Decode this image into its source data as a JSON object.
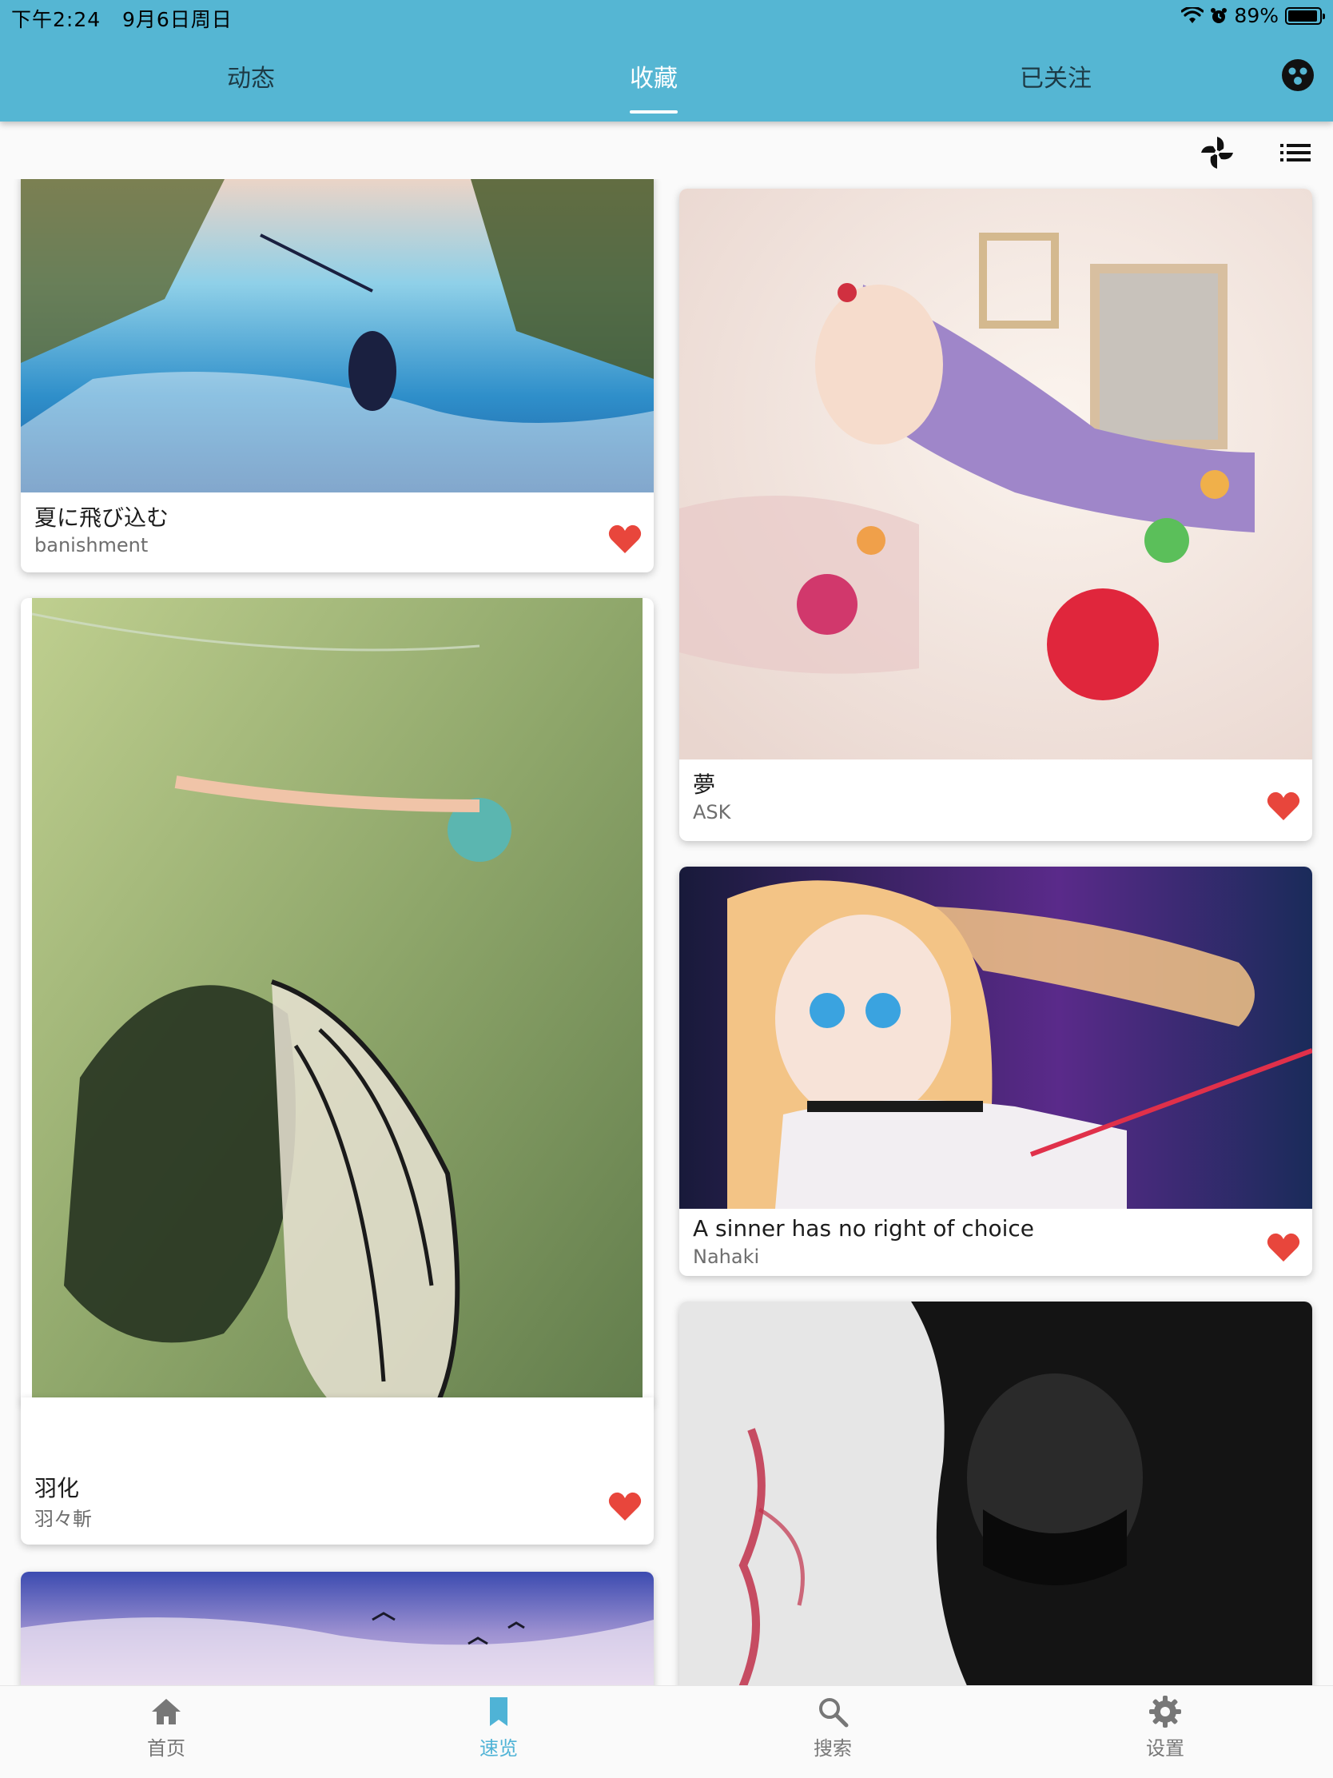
{
  "status_bar": {
    "time": "下午2:24",
    "date": "9月6日周日",
    "battery": "89%"
  },
  "tabs": [
    {
      "label": "动态"
    },
    {
      "label": "收藏"
    },
    {
      "label": "已关注"
    }
  ],
  "active_tab": "收藏",
  "toolbar": {
    "icons": [
      "pinwheel-icon",
      "list-icon"
    ]
  },
  "colors": {
    "header": "#55b6d3",
    "accent": "#4fb3d6",
    "heart": "#e8463c"
  },
  "cards": [
    {
      "title": "夏に飛び込む",
      "author": "banishment",
      "liked": true
    },
    {
      "title": "夢",
      "author": "ASK",
      "liked": true
    },
    {
      "title": "羽化",
      "author": "羽々斬",
      "liked": true
    },
    {
      "title": "A sinner has no right of choice",
      "author": "Nahaki",
      "liked": true
    }
  ],
  "bottom_nav": [
    {
      "label": "首页",
      "icon": "home-icon"
    },
    {
      "label": "速览",
      "icon": "bookmark-icon"
    },
    {
      "label": "搜索",
      "icon": "search-icon"
    },
    {
      "label": "设置",
      "icon": "gear-icon"
    }
  ],
  "active_nav": "速览"
}
